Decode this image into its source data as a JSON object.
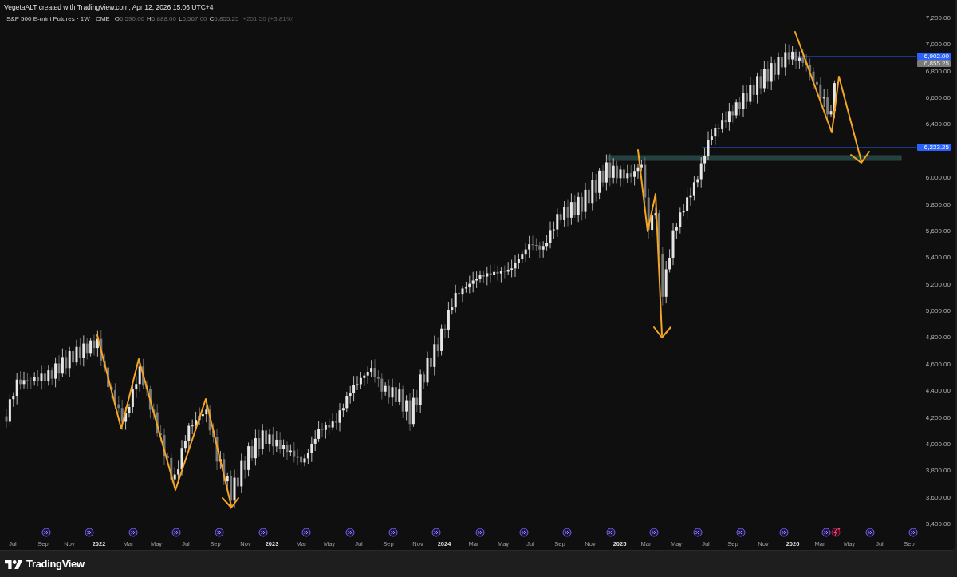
{
  "attribution": "VegetaALT created with TradingView.com, Apr 12, 2026 15:06 UTC+4",
  "legend": {
    "symbol": "S&P 500 E-mini Futures · 1W · CME",
    "ohlc": [
      {
        "label": "O",
        "value": "6,590.00"
      },
      {
        "label": "H",
        "value": "6,888.00"
      },
      {
        "label": "L",
        "value": "6,567.00"
      },
      {
        "label": "C",
        "value": "6,855.25"
      }
    ],
    "change": "+251.50 (+3.81%)"
  },
  "price_axis": {
    "ticks": [
      "7,200.00",
      "7,000.00",
      "6,800.00",
      "6,600.00",
      "6,400.00",
      "6,000.00",
      "5,800.00",
      "5,600.00",
      "5,400.00",
      "5,200.00",
      "5,000.00",
      "4,800.00",
      "4,600.00",
      "4,400.00",
      "4,200.00",
      "4,000.00",
      "3,800.00",
      "3,600.00",
      "3,400.00"
    ]
  },
  "price_labels": [
    {
      "text": "6,902.00",
      "kind": "line"
    },
    {
      "text": "6,855.25",
      "kind": "last"
    },
    {
      "text": "6,223.25",
      "kind": "line"
    }
  ],
  "time_axis": {
    "labels": [
      {
        "text": "Jul",
        "kind": "month"
      },
      {
        "text": "Sep",
        "kind": "month"
      },
      {
        "text": "Nov",
        "kind": "month"
      },
      {
        "text": "2022",
        "kind": "year"
      },
      {
        "text": "Mar",
        "kind": "month"
      },
      {
        "text": "May",
        "kind": "month"
      },
      {
        "text": "Jul",
        "kind": "month"
      },
      {
        "text": "Sep",
        "kind": "month"
      },
      {
        "text": "Nov",
        "kind": "month"
      },
      {
        "text": "2023",
        "kind": "year"
      },
      {
        "text": "Mar",
        "kind": "month"
      },
      {
        "text": "May",
        "kind": "month"
      },
      {
        "text": "Jul",
        "kind": "month"
      },
      {
        "text": "Sep",
        "kind": "month"
      },
      {
        "text": "Nov",
        "kind": "month"
      },
      {
        "text": "2024",
        "kind": "year"
      },
      {
        "text": "Mar",
        "kind": "month"
      },
      {
        "text": "May",
        "kind": "month"
      },
      {
        "text": "Jul",
        "kind": "month"
      },
      {
        "text": "Sep",
        "kind": "month"
      },
      {
        "text": "Nov",
        "kind": "month"
      },
      {
        "text": "2025",
        "kind": "year"
      },
      {
        "text": "Mar",
        "kind": "month"
      },
      {
        "text": "May",
        "kind": "month"
      },
      {
        "text": "Jul",
        "kind": "month"
      },
      {
        "text": "Sep",
        "kind": "month"
      },
      {
        "text": "Nov",
        "kind": "month"
      },
      {
        "text": "2026",
        "kind": "year"
      },
      {
        "text": "Mar",
        "kind": "month"
      },
      {
        "text": "May",
        "kind": "month"
      },
      {
        "text": "Jul",
        "kind": "month"
      },
      {
        "text": "Sep",
        "kind": "month"
      }
    ]
  },
  "footer": {
    "brand": "TradingView"
  }
}
